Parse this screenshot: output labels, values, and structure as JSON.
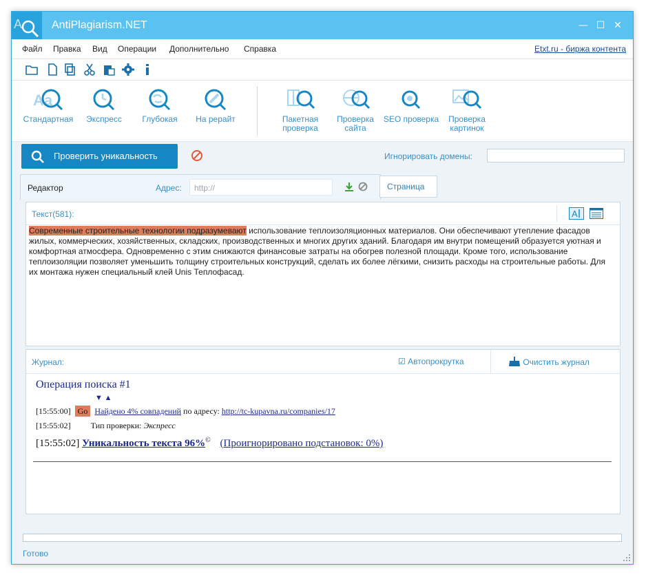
{
  "window": {
    "title": "AntiPlagiarism.NET"
  },
  "menu": {
    "items": [
      "Файл",
      "Правка",
      "Вид",
      "Операции",
      "Дополнительно",
      "Справка"
    ],
    "link": "Etxt.ru - биржа контента"
  },
  "ribbon": {
    "buttons": [
      {
        "label": "Стандартная"
      },
      {
        "label": "Экспресс"
      },
      {
        "label": "Глубокая"
      },
      {
        "label": "На рерайт"
      },
      {
        "label": "Пакетная проверка"
      },
      {
        "label": "Проверка сайта"
      },
      {
        "label": "SEO проверка"
      },
      {
        "label": "Проверка картинок"
      }
    ]
  },
  "check": {
    "button_label": "Проверить уникальность",
    "ignore_label": "Игнорировать домены:",
    "ignore_value": ""
  },
  "editor": {
    "tab_label": "Редактор",
    "address_label": "Адрес:",
    "address_placeholder": "http://",
    "page_tab": "Страница"
  },
  "text": {
    "count_label": "Текст(581):",
    "highlighted": "Современные строительные технологии подразумевают",
    "body": " использование теплоизоляционных материалов. Они обеспечивают утепление фасадов жилых, коммерческих, хозяйственных, складских, производственных и многих других зданий. Благодаря им внутри помещений образуется уютная и комфортная атмосфера. Одновременно с этим снижаются финансовые затраты на обогрев полезной площади. Кроме того, использование теплоизоляции позволяет уменьшить толщину строительных конструкций, сделать их более лёгкими, снизить расходы на строительные работы. Для их монтажа нужен специальный клей Unis Теплофасад."
  },
  "journal": {
    "label": "Журнал:",
    "autoscroll": "Автопрокрутка",
    "clear": "Очистить журнал",
    "op_title": "Операция поиска #1",
    "arrows": "▼ ▲",
    "line1": {
      "time": "[15:55:00]",
      "go": "Go",
      "found": "Найдено 4% совпадений",
      "by": "по адресу:",
      "url": "http://tc-kupavna.ru/companies/17"
    },
    "line2": {
      "time": "[15:55:02]",
      "type_label": "Тип проверки:",
      "type": "Экспресс"
    },
    "line3": {
      "time": "[15:55:02]",
      "uniq": "Уникальность текста 96%",
      "copy": "©",
      "ignored": "(Проигнорировано подстановок: 0%)"
    }
  },
  "status": {
    "text": "Готово",
    "progress": 0
  },
  "colors": {
    "accent": "#1687c2",
    "titlebar": "#5ac2f0",
    "highlight": "#e07b5b"
  }
}
